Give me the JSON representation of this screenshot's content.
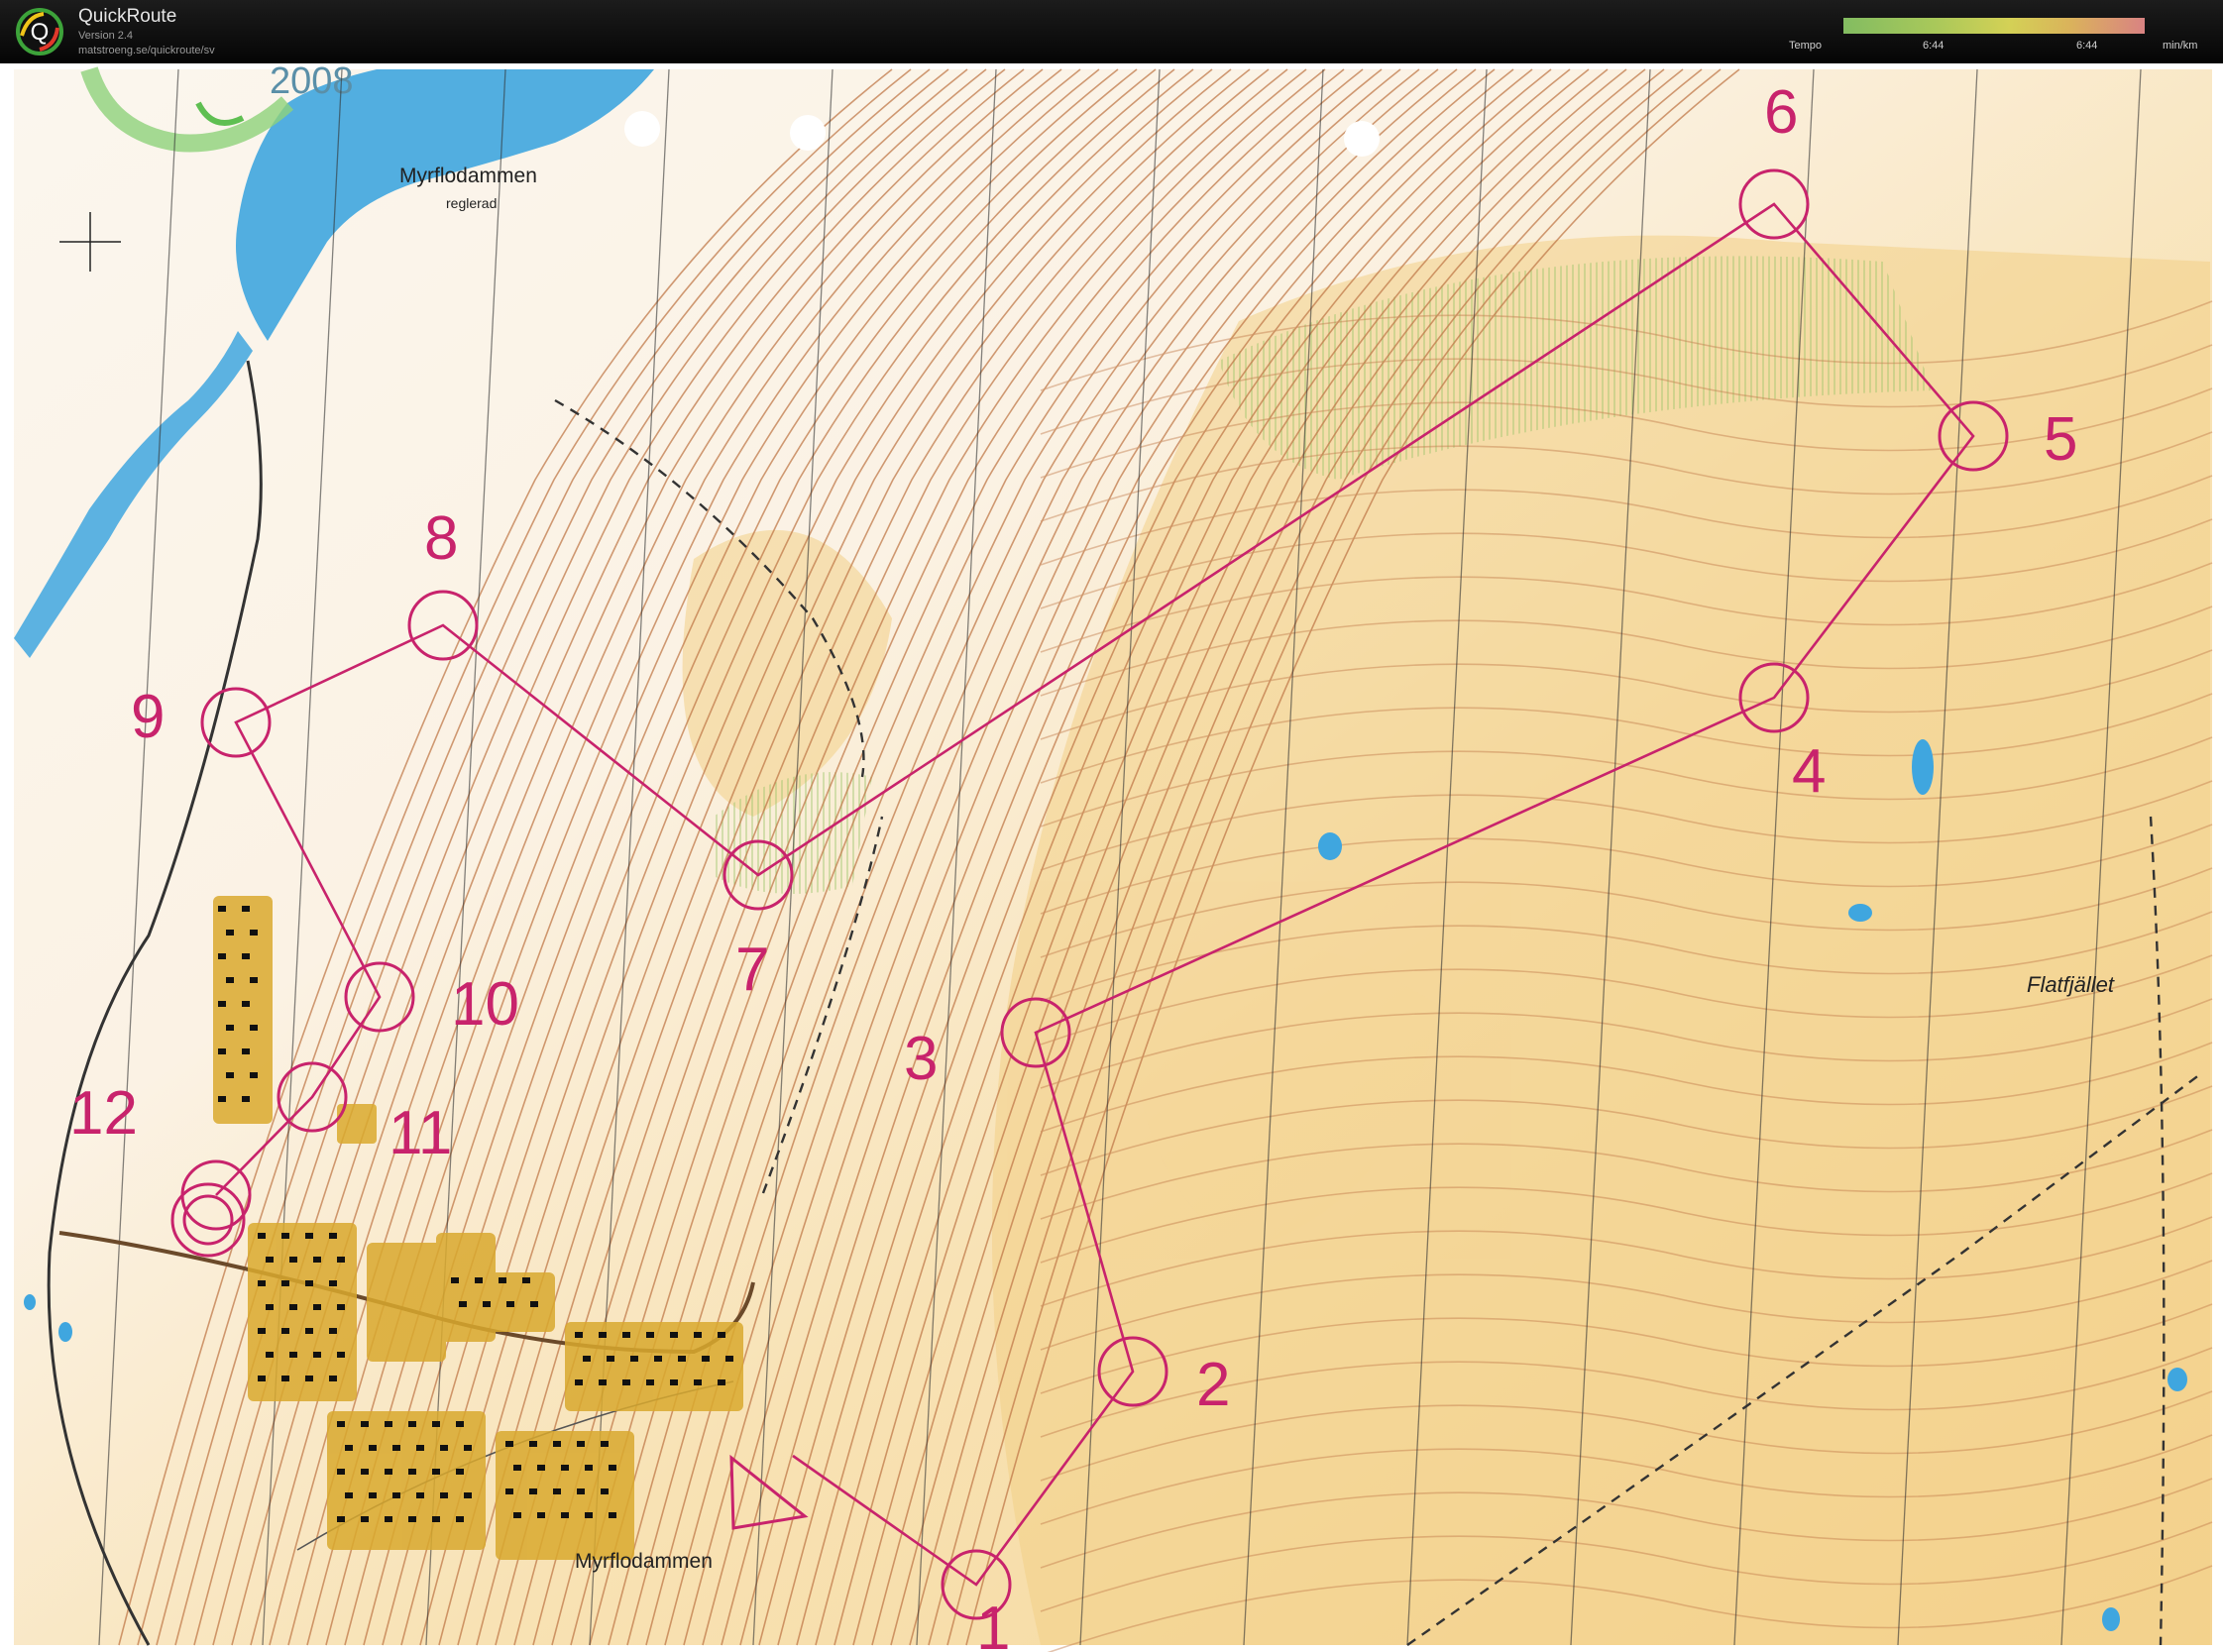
{
  "titlebar": {
    "app_name": "QuickRoute",
    "version": "Version 2.4",
    "url": "matstroeng.se/quickroute/sv",
    "logo_letter": "Q",
    "tempo_label": "Tempo",
    "tempo_tick_1": "6:44",
    "tempo_tick_2": "6:44",
    "tempo_unit": "min/km"
  },
  "map": {
    "event_year": "2008",
    "lake_label_top": "Myrflodammen",
    "lake_note": "reglerad",
    "lake_label_bottom": "Myrflodammen",
    "summit_label": "Flatfjället",
    "course_color": "#c8236c",
    "water_color": "#3fa6df",
    "terrain_color": "#f6dba0",
    "controls": [
      {
        "number": "1"
      },
      {
        "number": "2"
      },
      {
        "number": "3"
      },
      {
        "number": "4"
      },
      {
        "number": "5"
      },
      {
        "number": "6"
      },
      {
        "number": "7"
      },
      {
        "number": "8"
      },
      {
        "number": "9"
      },
      {
        "number": "10"
      },
      {
        "number": "11"
      },
      {
        "number": "12"
      }
    ]
  }
}
